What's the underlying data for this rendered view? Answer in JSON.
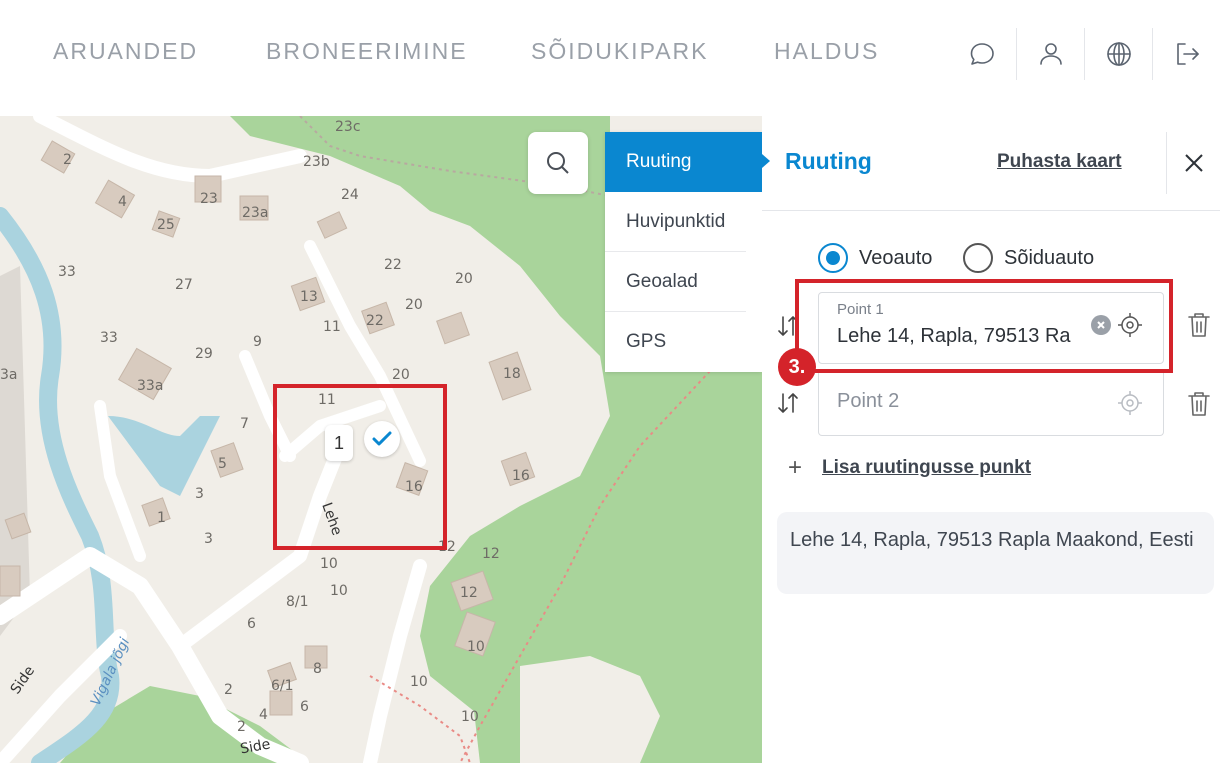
{
  "nav": {
    "items": [
      "ARUANDED",
      "BRONEERIMINE",
      "SÕIDUKIPARK",
      "HALDUS"
    ],
    "icons": [
      "chat-icon",
      "user-icon",
      "globe-icon",
      "logout-icon"
    ]
  },
  "map": {
    "house_numbers": [
      "23c",
      "2",
      "23b",
      "23",
      "4",
      "25",
      "23a",
      "24",
      "22",
      "20",
      "33",
      "27",
      "13",
      "11",
      "22",
      "20",
      "33",
      "29",
      "9",
      "18",
      "33a",
      "20",
      "11",
      "7",
      "5",
      "3",
      "1",
      "3",
      "16",
      "16",
      "12",
      "12",
      "10",
      "10",
      "8/1",
      "6",
      "8",
      "6/1",
      "2",
      "4",
      "2",
      "6",
      "10",
      "10",
      "3a",
      "12",
      "10"
    ],
    "streets": [
      "Lehe",
      "Side",
      "Side"
    ],
    "river": "Vigala jõgi",
    "marker_number": "1"
  },
  "side_menu": {
    "items": [
      "Ruuting",
      "Huvipunktid",
      "Geoalad",
      "GPS"
    ],
    "active": "Ruuting"
  },
  "panel": {
    "title": "Ruuting",
    "clear_label": "Puhasta kaart",
    "vehicle_types": [
      {
        "label": "Veoauto",
        "selected": true
      },
      {
        "label": "Sõiduauto",
        "selected": false
      }
    ],
    "point1": {
      "label": "Point 1",
      "value": "Lehe 14, Rapla, 79513 Ra"
    },
    "point2": {
      "placeholder": "Point 2"
    },
    "step_badge": "3.",
    "add_point_label": "Lisa ruutingusse punkt",
    "address_result": "Lehe 14, Rapla, 79513 Rapla Maakond, Eesti"
  },
  "colors": {
    "accent": "#0a87d0",
    "highlight": "#d4232a",
    "map_bg": "#f1eee8",
    "forest": "#a9d49b",
    "water": "#aad3df",
    "building": "#d8cbbf"
  }
}
